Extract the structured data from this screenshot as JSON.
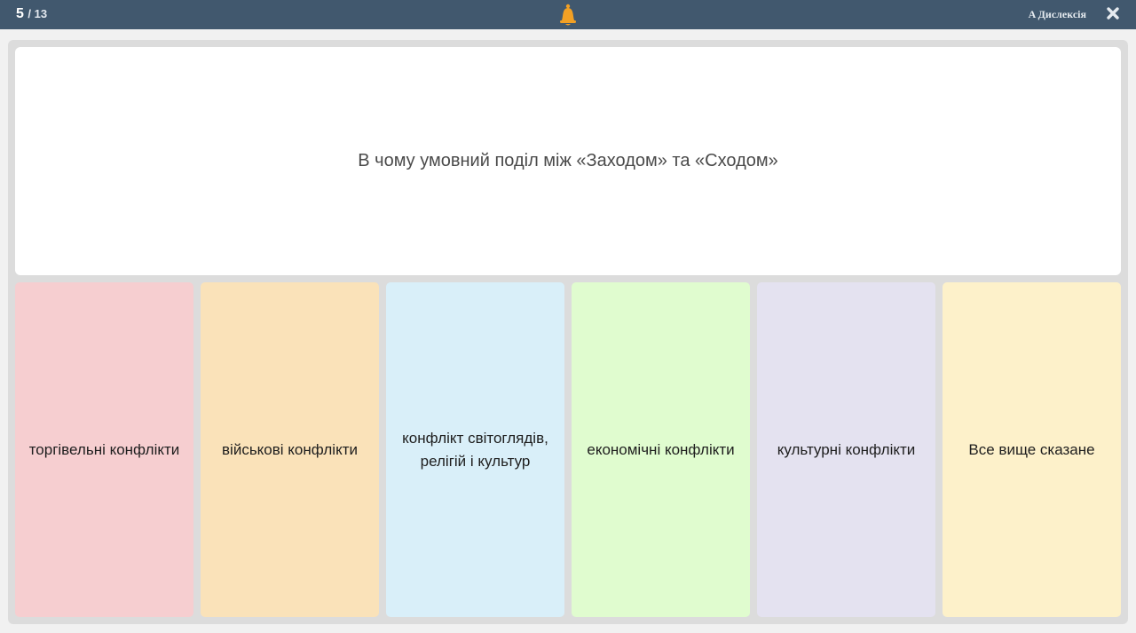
{
  "header": {
    "current": "5",
    "total": "/ 13",
    "dyslexia_label": "A Дислексія",
    "bell_icon": "bell-icon",
    "close_icon": "close-icon"
  },
  "question": {
    "text": "В чому умовний поділ між «Заходом» та «Сходом»"
  },
  "answers": [
    {
      "label": "торгівельні конфлікти",
      "color": "#f6ced0"
    },
    {
      "label": "військові конфлікти",
      "color": "#fae2b9"
    },
    {
      "label": "конфлікт світоглядів, релігій і культур",
      "color": "#d9eff9"
    },
    {
      "label": "економічні конфлікти",
      "color": "#e0fccf"
    },
    {
      "label": "культурні конфлікти",
      "color": "#e4e2f0"
    },
    {
      "label": "Все вище сказане",
      "color": "#fdf1ca"
    }
  ],
  "colors": {
    "topbar": "#41586e",
    "bell": "#f2a024"
  }
}
